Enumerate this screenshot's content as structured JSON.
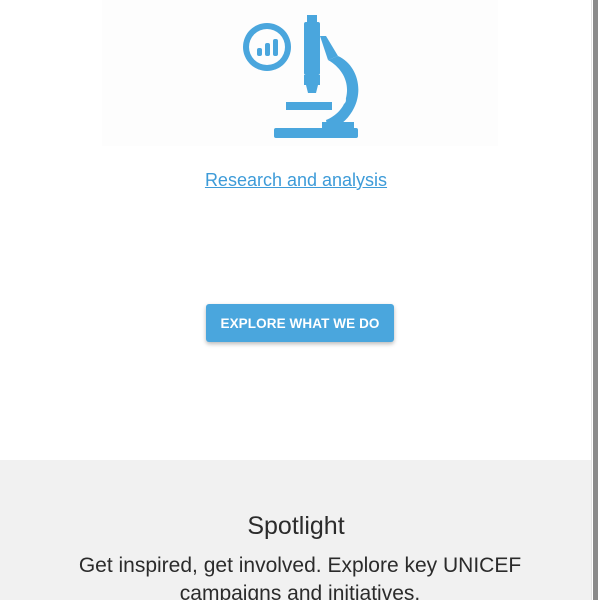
{
  "research": {
    "icon": "microscope-icon",
    "link_label": "Research and analysis"
  },
  "cta": {
    "label": "EXPLORE WHAT WE DO"
  },
  "spotlight": {
    "title": "Spotlight",
    "text": "Get inspired, get involved. Explore key UNICEF campaigns and initiatives."
  },
  "colors": {
    "accent": "#4aa6dd",
    "link": "#3d9bd8",
    "spotlight_bg": "#f1f1f1",
    "text": "#2b2b2b"
  }
}
